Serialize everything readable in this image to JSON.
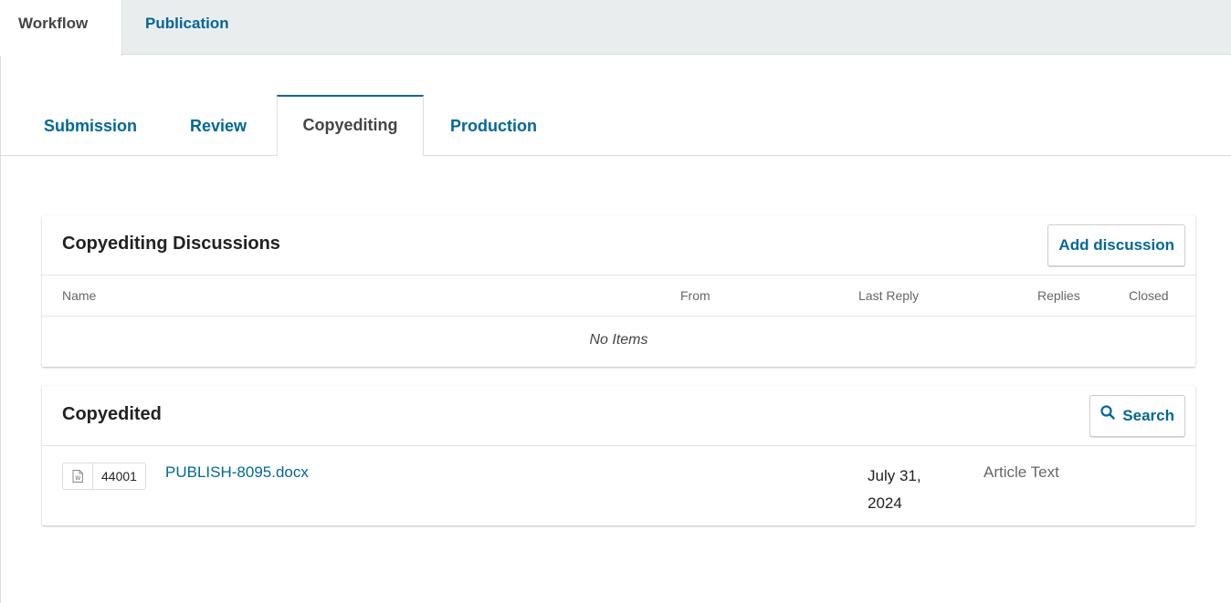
{
  "top_tabs": {
    "active": "Workflow",
    "inactive": "Publication"
  },
  "stage_tabs": [
    "Submission",
    "Review",
    "Copyediting",
    "Production"
  ],
  "discussions": {
    "title": "Copyediting Discussions",
    "add_button": "Add discussion",
    "columns": {
      "name": "Name",
      "from": "From",
      "last_reply": "Last Reply",
      "replies": "Replies",
      "closed": "Closed"
    },
    "empty_text": "No Items"
  },
  "copyedited": {
    "title": "Copyedited",
    "search_button": "Search",
    "search_icon": "search-icon",
    "files": [
      {
        "icon": "word-file-icon",
        "id": "44001",
        "name": "PUBLISH-8095.docx",
        "date_line1": "July 31,",
        "date_line2": "2024",
        "genre": "Article Text"
      }
    ]
  },
  "colors": {
    "accent": "#006798",
    "tab_bar": "#eaedee",
    "border": "#dddddd"
  }
}
